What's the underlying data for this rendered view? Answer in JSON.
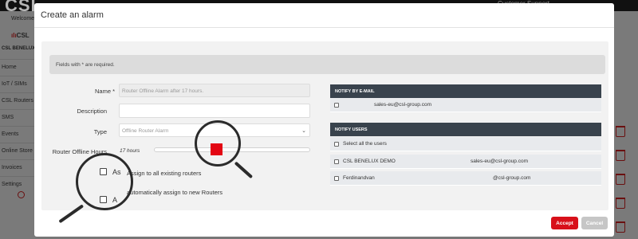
{
  "background": {
    "brand": "CSL",
    "support_text": "Customer Support",
    "welcome": "Welcome",
    "logo_mark": "ılı",
    "logo_text": "CSL",
    "company": "CSL BENELUX D",
    "nav": [
      {
        "label": "Home"
      },
      {
        "label": "IoT / SIMs"
      },
      {
        "label": "CSL Routers"
      },
      {
        "label": "SMS"
      },
      {
        "label": "Events"
      },
      {
        "label": "Online Store"
      },
      {
        "label": "Invoices"
      },
      {
        "label": "Settings"
      }
    ]
  },
  "modal": {
    "title": "Create an alarm",
    "required_note": "Fields with * are required.",
    "form": {
      "name_label": "Name *",
      "name_placeholder": "Router Offline Alarm after 17 hours.",
      "description_label": "Description",
      "description_value": "",
      "type_label": "Type",
      "type_value": "Offline Router Alarm",
      "hours_label": "Router Offline Hours",
      "hours_value": "17 hours",
      "hours_level_percent": 40,
      "assign_existing_stub": "As",
      "assign_existing_label": "Assign to all existing routers",
      "assign_new_stub": "A",
      "assign_new_label": "automatically assign to new Routers"
    },
    "email_panel": {
      "header": "NOTIFY BY E-MAIL",
      "rows": [
        {
          "email": "sales-eu@csl-group.com"
        }
      ]
    },
    "users_panel": {
      "header": "NOTIFY USERS",
      "select_all": "Select all the users",
      "users": [
        {
          "name": "CSL BENELUX DEMO",
          "email": "sales-eu@csl-group.com"
        },
        {
          "name": "Ferdinandvan",
          "email": "@csl-group.com"
        }
      ]
    },
    "buttons": {
      "accept": "Accept",
      "cancel": "Cancel"
    },
    "colors": {
      "accent": "#e30613",
      "accept_button": "#d8101a",
      "cancel_button": "#c6c6c6",
      "panel_header": "#39434d"
    }
  }
}
